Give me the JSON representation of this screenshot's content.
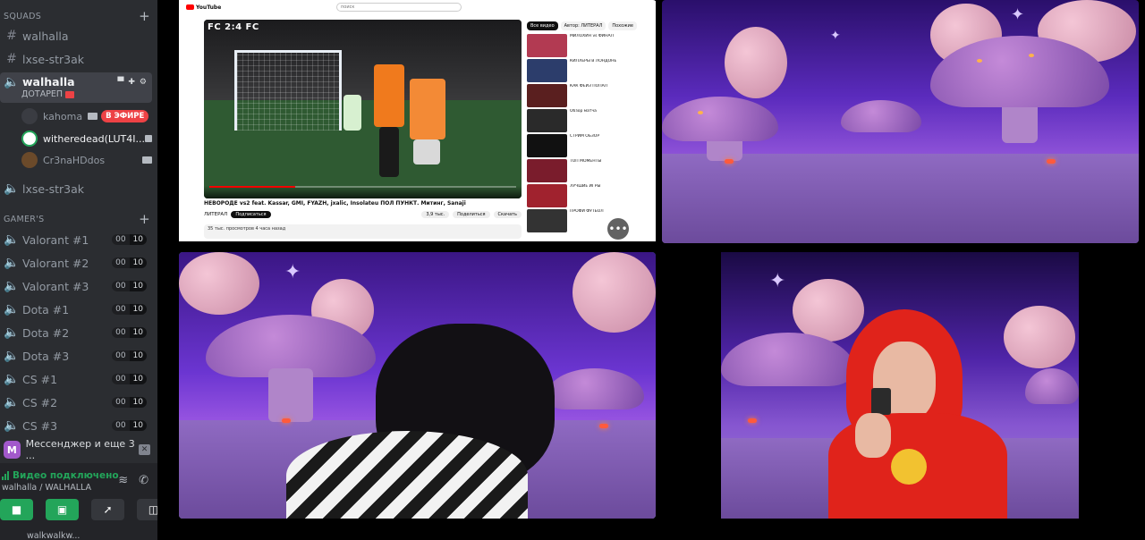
{
  "sidebar": {
    "categories": [
      {
        "label": "SQUADS"
      },
      {
        "label": "GAMER'S"
      }
    ],
    "squad_channels": [
      {
        "name": "walhalla"
      },
      {
        "name": "lxse-str3ak"
      }
    ],
    "active_voice": {
      "name": "walhalla",
      "subtitle": "ДОТАРЕП",
      "members": [
        {
          "name": "kahoma",
          "badge": "В ЭФИРЕ"
        },
        {
          "name": "witheredead(LUT4I..."
        },
        {
          "name": "Cr3naHDdos"
        }
      ]
    },
    "after_voice_channel": {
      "name": "lxse-str3ak"
    },
    "gamer_channels": [
      {
        "name": "Valorant #1",
        "count": "00",
        "limit": "10"
      },
      {
        "name": "Valorant #2",
        "count": "00",
        "limit": "10"
      },
      {
        "name": "Valorant #3",
        "count": "00",
        "limit": "10"
      },
      {
        "name": "Dota #1",
        "count": "00",
        "limit": "10"
      },
      {
        "name": "Dota #2",
        "count": "00",
        "limit": "10"
      },
      {
        "name": "Dota #3",
        "count": "00",
        "limit": "10"
      },
      {
        "name": "CS #1",
        "count": "00",
        "limit": "10"
      },
      {
        "name": "CS #2",
        "count": "00",
        "limit": "10"
      },
      {
        "name": "CS #3",
        "count": "00",
        "limit": "10"
      }
    ],
    "notice": {
      "text": "Мессенджер и еще 3 ...",
      "icon_letter": "M"
    },
    "voice_panel": {
      "status": "Видео подключено",
      "location": "walhalla / WALHALLA"
    },
    "bottom_user": "walkwalkw..."
  },
  "stage": {
    "youtube": {
      "logo": "YouTube",
      "search_placeholder": "поиск",
      "video_overlay_title": "FC 2:4 FC",
      "video_title": "НЕВОРОДЕ vs2 feat. Kassar, GMI, FYAZH, jxalic, Insolateu ПОЛ ПУНКТ. Митинг, Sanaji",
      "channel": "ЛИТЕРАЛ",
      "subscribe": "Подписаться",
      "likes": "3,9 тыс.",
      "share": "Поделиться",
      "download": "Скачать",
      "description": "35 тыс. просмотров 4 часа назад",
      "chips": [
        "Все видео",
        "Автор: ЛИТЕРАЛ",
        "Похожие"
      ],
      "progress": 0.28,
      "recommendations": [
        {
          "title": "МИЛОХИН vs ФИНАЛ"
        },
        {
          "title": "КИЛЛЕРЫ В ЛОНДОНЕ"
        },
        {
          "title": "КАК ФЕЙЗ ПОПАЛ"
        },
        {
          "title": "Обзор матча"
        },
        {
          "title": "СТРИМ ОБЗОР"
        },
        {
          "title": "ТОП МОМЕНТЫ"
        },
        {
          "title": "ЛУЧШИЕ ИГРЫ"
        },
        {
          "title": "ПРОФИ ФУТБОЛ"
        }
      ]
    }
  },
  "colors": {
    "accent_green": "#23a55a",
    "live_red": "#ed4245",
    "sidebar_bg": "#2b2d31"
  }
}
